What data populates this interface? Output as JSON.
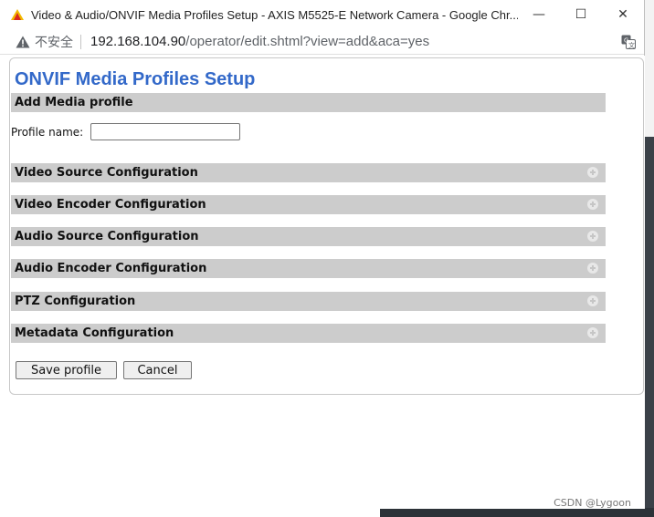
{
  "window": {
    "title": "Video & Audio/ONVIF Media Profiles Setup - AXIS M5525-E Network Camera - Google Chr...",
    "minimize_glyph": "—",
    "maximize_glyph": "☐",
    "close_glyph": "✕"
  },
  "address": {
    "security_label": "不安全",
    "url_host": "192.168.104.90",
    "url_path": "/operator/edit.shtml?view=add&aca=yes"
  },
  "dialog": {
    "title": "ONVIF Media Profiles Setup",
    "add_section": "Add Media profile",
    "profile_name_label": "Profile name:",
    "profile_name_value": "",
    "sections": [
      "Video Source Configuration",
      "Video Encoder Configuration",
      "Audio Source Configuration",
      "Audio Encoder Configuration",
      "PTZ Configuration",
      "Metadata Configuration"
    ],
    "save_label": "Save profile",
    "cancel_label": "Cancel"
  },
  "watermark": "CSDN @Lygoon",
  "colors": {
    "title_blue": "#3369c9",
    "bar_gray": "#cccccc",
    "warning_icon": "#5f6368"
  },
  "icons": {
    "app": "axis-logo-icon",
    "security": "warning-triangle-icon",
    "translate": "translate-icon",
    "expand": "plus-circle-icon"
  }
}
